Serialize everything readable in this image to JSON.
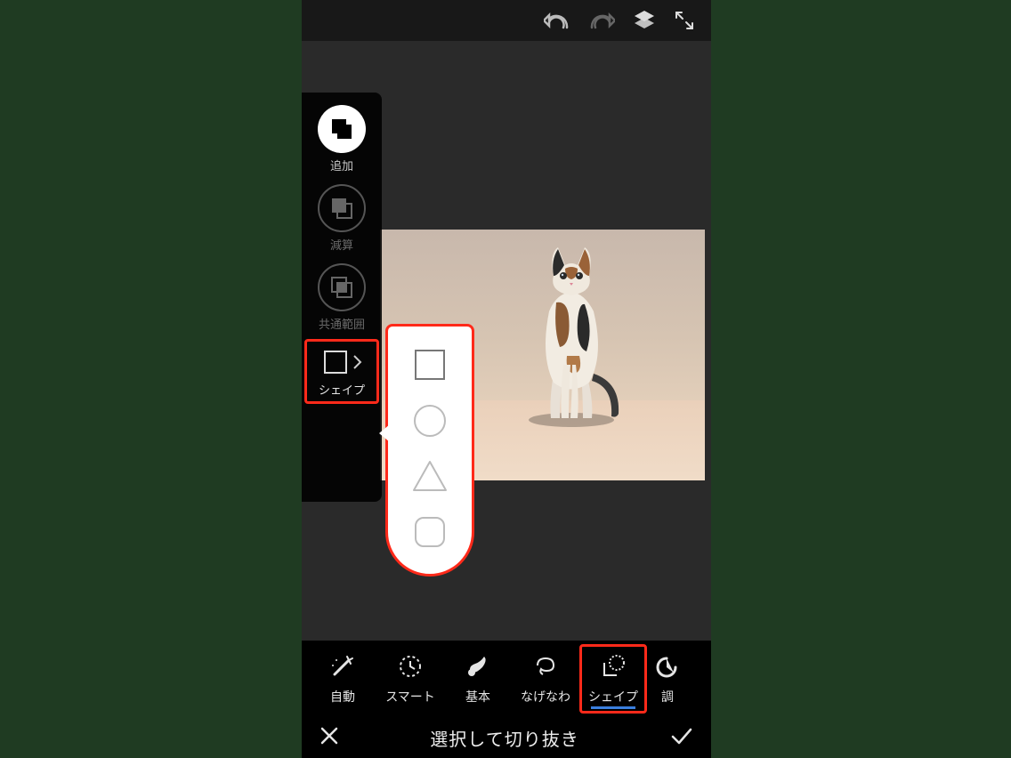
{
  "topbar": {
    "undo": "undo",
    "redo": "redo",
    "layers": "layers",
    "fullscreen": "fullscreen"
  },
  "sideTools": {
    "add": "追加",
    "subtract": "減算",
    "intersect": "共通範囲",
    "shape": "シェイプ"
  },
  "shapePopup": {
    "options": [
      "square",
      "circle",
      "triangle",
      "rounded-square"
    ]
  },
  "bottomTools": {
    "auto": "自動",
    "smart": "スマート",
    "basic": "基本",
    "lasso": "なげなわ",
    "shape": "シェイプ",
    "adjust": "調"
  },
  "footer": {
    "title": "選択して切り抜き"
  },
  "highlight_color": "#ff2a1a",
  "canvas": {
    "subject": "cat on transparent background"
  }
}
